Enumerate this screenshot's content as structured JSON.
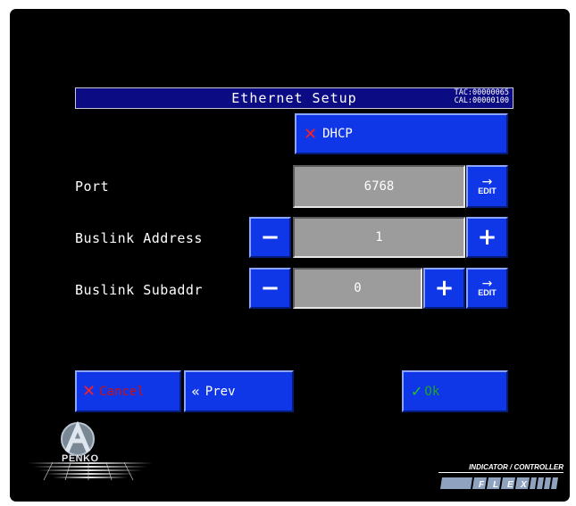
{
  "header": {
    "title": "Ethernet Setup",
    "tac": "TAC:00000065",
    "cal": "CAL:00000100"
  },
  "dhcp": {
    "label": "DHCP",
    "icon": "x-mark-icon"
  },
  "port": {
    "label": "Port",
    "value": "6768",
    "edit_label": "EDIT"
  },
  "buslink_address": {
    "label": "Buslink Address",
    "value": "1",
    "minus": "−",
    "plus": "+"
  },
  "buslink_subaddr": {
    "label": "Buslink Subaddr",
    "value": "0",
    "minus": "−",
    "plus": "+",
    "edit_label": "EDIT"
  },
  "footer": {
    "cancel_label": "Cancel",
    "prev_label": "Prev",
    "ok_label": "Ok"
  },
  "branding": {
    "logo_text": "PENKO",
    "product_line": "INDICATOR / CONTROLLER",
    "product_name": "FLEX"
  },
  "colors": {
    "button_blue": "#0f37e8",
    "title_bar": "#0b0b84",
    "field_gray": "#9c9c9c",
    "cancel_red": "#cc1010",
    "ok_green": "#1fa61f"
  }
}
